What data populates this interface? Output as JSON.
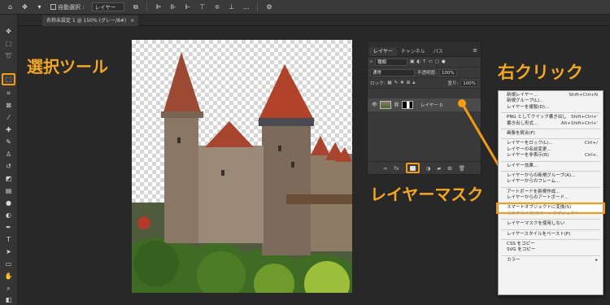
{
  "topbar": {
    "auto_select_label": "自動選択 :",
    "layer_select": "レイヤー"
  },
  "document": {
    "tab_title": "名称未設定 1 @ 150% (グレー/8#)",
    "close_glyph": "×"
  },
  "callouts": {
    "select_tool": "選択ツール",
    "right_click": "右クリック",
    "layer_mask": "レイヤーマスク"
  },
  "layers_panel": {
    "tabs": [
      "レイヤー",
      "チャンネル",
      "パス"
    ],
    "filter_label": "種類",
    "blend_mode": "通常",
    "opacity_label": "不透明度:",
    "opacity_value": "100%",
    "lock_label": "ロック:",
    "fill_label": "塗り:",
    "fill_value": "100%",
    "layer_name": "レイヤー 0"
  },
  "context_menu": {
    "items": [
      {
        "label": "新規レイヤー...",
        "shortcut": "Shift+Ctrl+N"
      },
      {
        "label": "新規グループ(L)...",
        "shortcut": ""
      },
      {
        "label": "レイヤーを複製(D)...",
        "shortcut": ""
      },
      {
        "sep": true
      },
      {
        "label": "PNG としてクイック書き出し",
        "shortcut": "Shift+Ctrl+'"
      },
      {
        "label": "書き出し形式...",
        "shortcut": "Alt+Shift+Ctrl+'"
      },
      {
        "sep": true
      },
      {
        "label": "画像を統合(F)",
        "shortcut": ""
      },
      {
        "sep": true
      },
      {
        "label": "レイヤーをロック(L)...",
        "shortcut": "Ctrl+/"
      },
      {
        "label": "レイヤーの名前変更...",
        "shortcut": ""
      },
      {
        "label": "レイヤーを非表示(R)",
        "shortcut": "Ctrl+,"
      },
      {
        "sep": true
      },
      {
        "label": "レイヤー効果...",
        "shortcut": ""
      },
      {
        "sep": true
      },
      {
        "label": "レイヤーからの新規グループ(A)...",
        "shortcut": ""
      },
      {
        "label": "レイヤーからのフレーム...",
        "shortcut": ""
      },
      {
        "sep": true
      },
      {
        "label": "アートボードを新規作成...",
        "shortcut": ""
      },
      {
        "label": "レイヤーからのアートボード...",
        "shortcut": ""
      },
      {
        "sep": true
      },
      {
        "label": "スマートオブジェクトに変換(S)",
        "shortcut": "",
        "highlight": true
      },
      {
        "label": "ラスタライズ/スマートオブジェクト",
        "shortcut": "",
        "disabled": true
      },
      {
        "sep": true
      },
      {
        "label": "レイヤーマスクを使用しない",
        "shortcut": ""
      },
      {
        "sep": true
      },
      {
        "label": "レイヤースタイルをペースト(P)",
        "shortcut": ""
      },
      {
        "sep": true
      },
      {
        "label": "CSS をコピー",
        "shortcut": ""
      },
      {
        "label": "SVG をコピー",
        "shortcut": ""
      },
      {
        "sep": true
      },
      {
        "label": "カラー",
        "shortcut": "▸"
      }
    ]
  },
  "accent_color": "#f39c12"
}
